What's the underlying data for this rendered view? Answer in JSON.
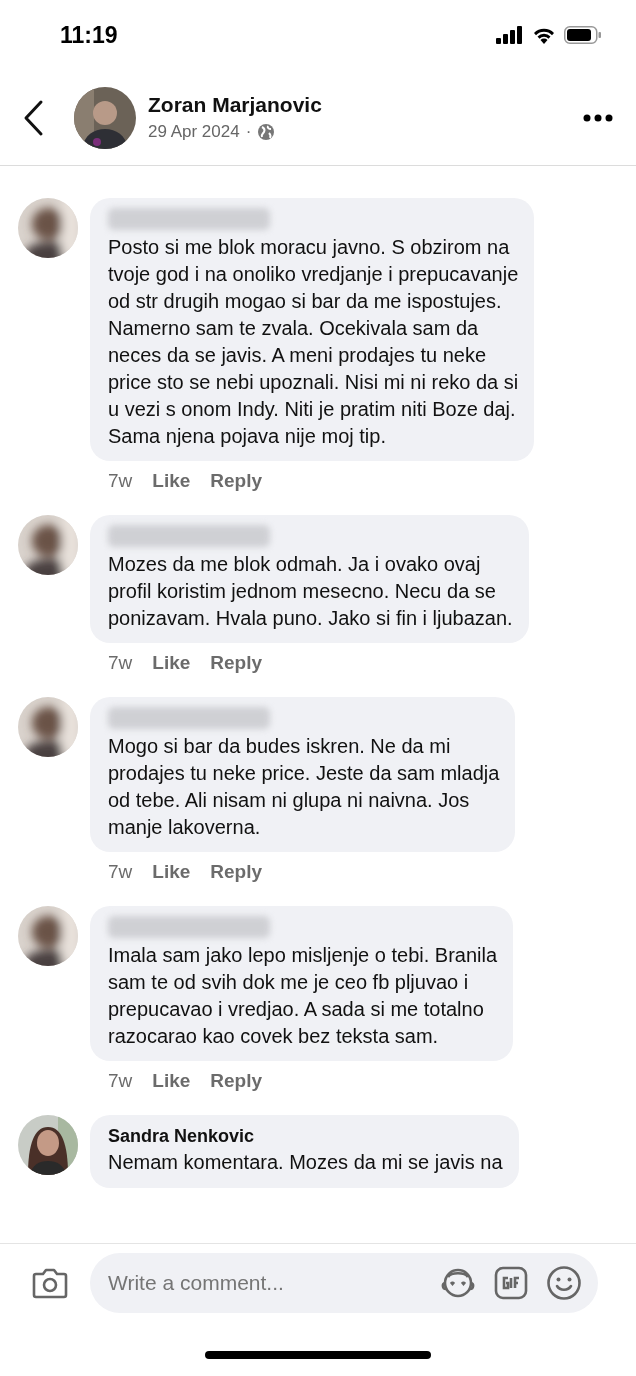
{
  "status_bar": {
    "time": "11:19"
  },
  "header": {
    "title": "Zoran Marjanovic",
    "date": "29 Apr 2024",
    "separator": "·"
  },
  "comments": [
    {
      "name_blurred": true,
      "lines": [
        "Posto si me blok moracu javno. S obzirom na",
        "tvoje god i na onoliko vredjanje i prepucavanje",
        "od str drugih mogao si bar da me ispostujes.",
        "Namerno sam te zvala. Ocekivala sam da",
        "neces da se javis. A meni prodajes tu neke",
        "price sto se nebi upoznali. Nisi mi ni reko da si",
        "u vezi s onom Indy. Niti je pratim niti Boze daj.",
        "Sama njena pojava nije moj tip."
      ],
      "time": "7w",
      "like": "Like",
      "reply": "Reply"
    },
    {
      "name_blurred": true,
      "lines": [
        "Mozes da me blok odmah. Ja i ovako ovaj",
        "profil koristim jednom mesecno. Necu da se",
        "ponizavam. Hvala puno. Jako si fin i ljubazan."
      ],
      "time": "7w",
      "like": "Like",
      "reply": "Reply"
    },
    {
      "name_blurred": true,
      "lines": [
        "Mogo si bar da budes iskren. Ne da mi",
        "prodajes tu neke price. Jeste da sam mladja",
        "od tebe. Ali nisam ni glupa ni naivna. Jos",
        "manje lakoverna."
      ],
      "time": "7w",
      "like": "Like",
      "reply": "Reply"
    },
    {
      "name_blurred": true,
      "lines": [
        "Imala sam jako lepo misljenje o tebi. Branila",
        "sam te od svih dok me je ceo fb pljuvao i",
        "prepucavao i vredjao. A sada si me totalno",
        "razocarao kao covek bez teksta sam."
      ],
      "time": "7w",
      "like": "Like",
      "reply": "Reply"
    },
    {
      "name_blurred": false,
      "name": "Sandra Nenkovic",
      "lines": [
        "Nemam komentara. Mozes da mi se javis na"
      ]
    }
  ],
  "composer": {
    "placeholder": "Write a comment..."
  }
}
